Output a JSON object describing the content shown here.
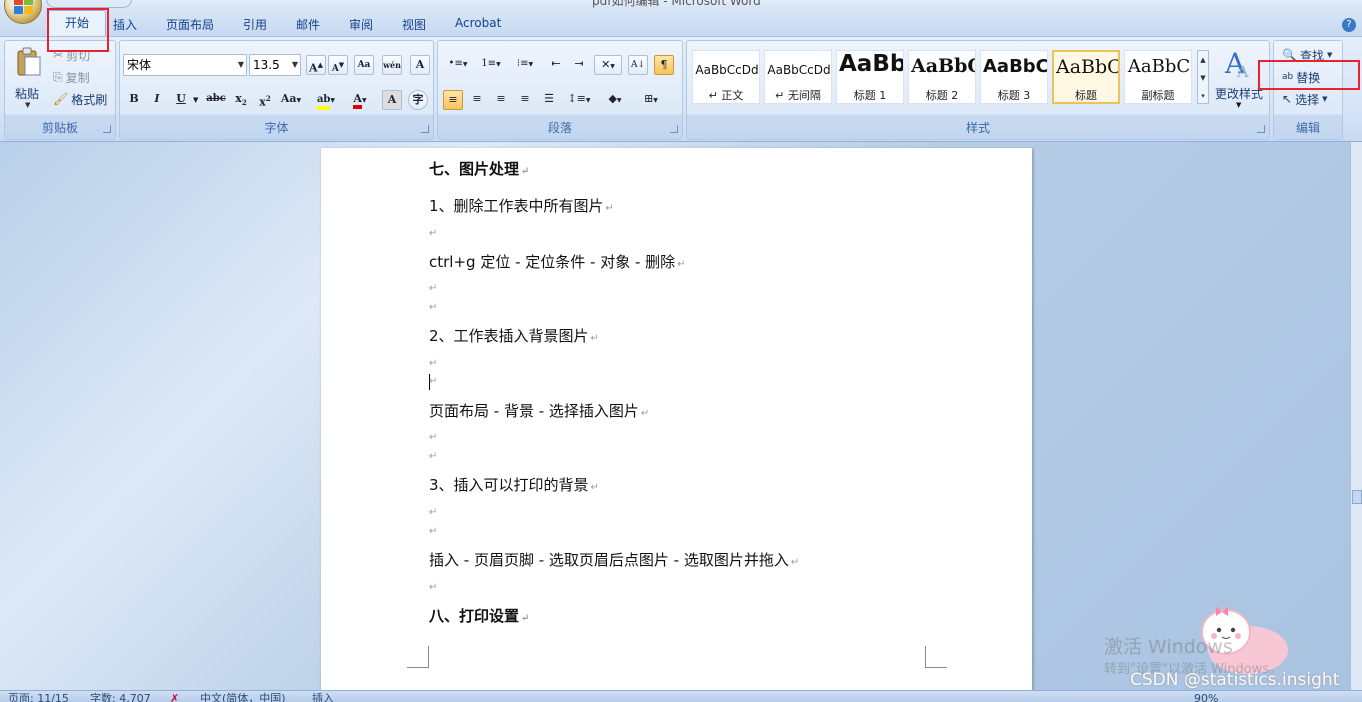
{
  "window": {
    "title": "pdf如何编辑 - Microsoft Word"
  },
  "tabs": [
    {
      "label": "开始",
      "active": true
    },
    {
      "label": "插入"
    },
    {
      "label": "页面布局"
    },
    {
      "label": "引用"
    },
    {
      "label": "邮件"
    },
    {
      "label": "审阅"
    },
    {
      "label": "视图"
    },
    {
      "label": "Acrobat"
    }
  ],
  "clipboard": {
    "label": "剪贴板",
    "paste": "粘贴",
    "cut": "剪切",
    "copy": "复制",
    "format_painter": "格式刷"
  },
  "font": {
    "label": "字体",
    "name": "宋体",
    "size": "13.5"
  },
  "paragraph": {
    "label": "段落"
  },
  "styles": {
    "label": "样式",
    "items": [
      {
        "sample": "AaBbCcDd",
        "name": "↵ 正文"
      },
      {
        "sample": "AaBbCcDd",
        "name": "↵ 无间隔"
      },
      {
        "sample": "AaBb",
        "name": "标题 1"
      },
      {
        "sample": "AaBbC",
        "name": "标题 2"
      },
      {
        "sample": "AaBbC",
        "name": "标题 3"
      },
      {
        "sample": "AaBbC",
        "name": "标题",
        "selected": true
      },
      {
        "sample": "AaBbC",
        "name": "副标题"
      }
    ],
    "change": "更改样式"
  },
  "editing": {
    "label": "编辑",
    "find": "查找",
    "replace": "替换",
    "select": "选择"
  },
  "document": {
    "lines": [
      {
        "text": "七、图片处理",
        "bold": true
      },
      {
        "text": "1、删除工作表中所有图片"
      },
      {
        "text": "ctrl+g 定位 - 定位条件 - 对象 - 删除"
      },
      {
        "text": "2、工作表插入背景图片"
      },
      {
        "text": "页面布局 - 背景 - 选择插入图片"
      },
      {
        "text": "3、插入可以打印的背景"
      },
      {
        "text": "插入 - 页眉页脚 - 选取页眉后点图片 - 选取图片并拖入"
      },
      {
        "text": "八、打印设置",
        "bold": true
      }
    ],
    "para_mark": "↵"
  },
  "status": {
    "page": "页面: 11/15",
    "words": "字数: 4,707",
    "lang": "中文(简体，中国)",
    "mode": "插入",
    "zoom": "90%"
  },
  "overlay": {
    "activate_title": "激活 Windows",
    "activate_sub": "转到\"设置\"以激活 Windows。",
    "csdn": "CSDN @statistics.insight"
  },
  "colors": {
    "highlight_red": "#e8232e",
    "ribbon_text": "#15428b",
    "font_color_bar": "#e00000",
    "highlight_yellow": "#ffff00"
  }
}
